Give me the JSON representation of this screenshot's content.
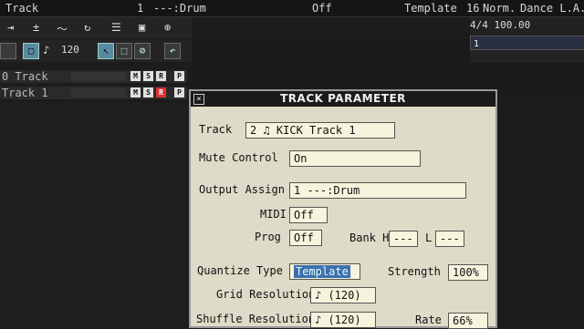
{
  "header": {
    "track_label": "Track",
    "track_num": "1",
    "output": "---:Drum",
    "mute_value": "Off",
    "quantize": "Template",
    "grid": "16",
    "style": "Norm.",
    "groove": "Dance L.A."
  },
  "toolbar": {
    "tempo": "120"
  },
  "timeline": {
    "meter": "4/4 100.00",
    "marker": "1"
  },
  "tracks": [
    {
      "label": "0 Track"
    },
    {
      "label": "Track 1"
    }
  ],
  "dialog": {
    "title": "TRACK PARAMETER",
    "track_label": "Track",
    "track_value": "2 ♫ KICK Track 1",
    "mute_label": "Mute Control",
    "mute_value": "On",
    "output_label": "Output Assign",
    "output_value": "1 ---:Drum",
    "midi_label": "MIDI",
    "midi_value": "Off",
    "prog_label": "Prog",
    "prog_value": "Off",
    "bank_label": "Bank H",
    "bank_l_label": "L",
    "bank_h_value": "---",
    "bank_l_value": "---",
    "quantize_label": "Quantize Type",
    "quantize_value": "Template",
    "strength_label": "Strength",
    "strength_value": "100%",
    "grid_label": "Grid Resolution",
    "grid_value": "♪ (120)",
    "shuffle_label": "Shuffle Resolution",
    "shuffle_value": "♪ (120)",
    "rate_label": "Rate",
    "rate_value": "66%"
  }
}
